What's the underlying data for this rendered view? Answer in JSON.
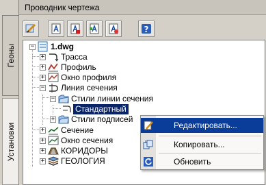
{
  "window": {
    "title": "Проводник чертежа"
  },
  "side_tabs": [
    {
      "label": "Геоны",
      "active": false
    },
    {
      "label": "Установки",
      "active": true
    }
  ],
  "toolbar": {
    "buttons": [
      {
        "icon": "settings-pencil-icon"
      },
      {
        "icon": "label-style-icon"
      },
      {
        "icon": "label-style-edit-icon"
      },
      {
        "icon": "label-style-alt-icon"
      },
      {
        "icon": "label-style-delete-icon"
      },
      {
        "icon": "help-icon"
      }
    ]
  },
  "tree": {
    "root": "1.dwg",
    "items": [
      {
        "label": "Трасса",
        "icon": "alignment-icon"
      },
      {
        "label": "Профиль",
        "icon": "profile-icon"
      },
      {
        "label": "Окно профиля",
        "icon": "profile-view-icon"
      },
      {
        "label": "Линия сечения",
        "icon": "sample-line-icon"
      },
      {
        "label": "Стили линии сечения",
        "icon": "folder-icon"
      },
      {
        "label": "Стандартный",
        "icon": "style-icon",
        "selected": true
      },
      {
        "label": "Стили подписей",
        "icon": "folder-icon"
      },
      {
        "label": "Сечение",
        "icon": "section-icon"
      },
      {
        "label": "Окно сечения",
        "icon": "section-view-icon"
      },
      {
        "label": "КОРИДОРЫ",
        "icon": "corridor-icon"
      },
      {
        "label": "ГЕОЛОГИЯ",
        "icon": "geology-icon"
      }
    ]
  },
  "context_menu": {
    "items": [
      {
        "label": "Редактировать...",
        "icon": "edit-icon",
        "highlighted": true
      },
      {
        "label": "Копировать...",
        "icon": "copy-icon"
      },
      {
        "label": "Обновить",
        "icon": "refresh-icon"
      }
    ]
  },
  "colors": {
    "selection": "#0a246a",
    "menu_highlight": "#0a3c9a",
    "panel_bg": "#d4d0c8"
  }
}
